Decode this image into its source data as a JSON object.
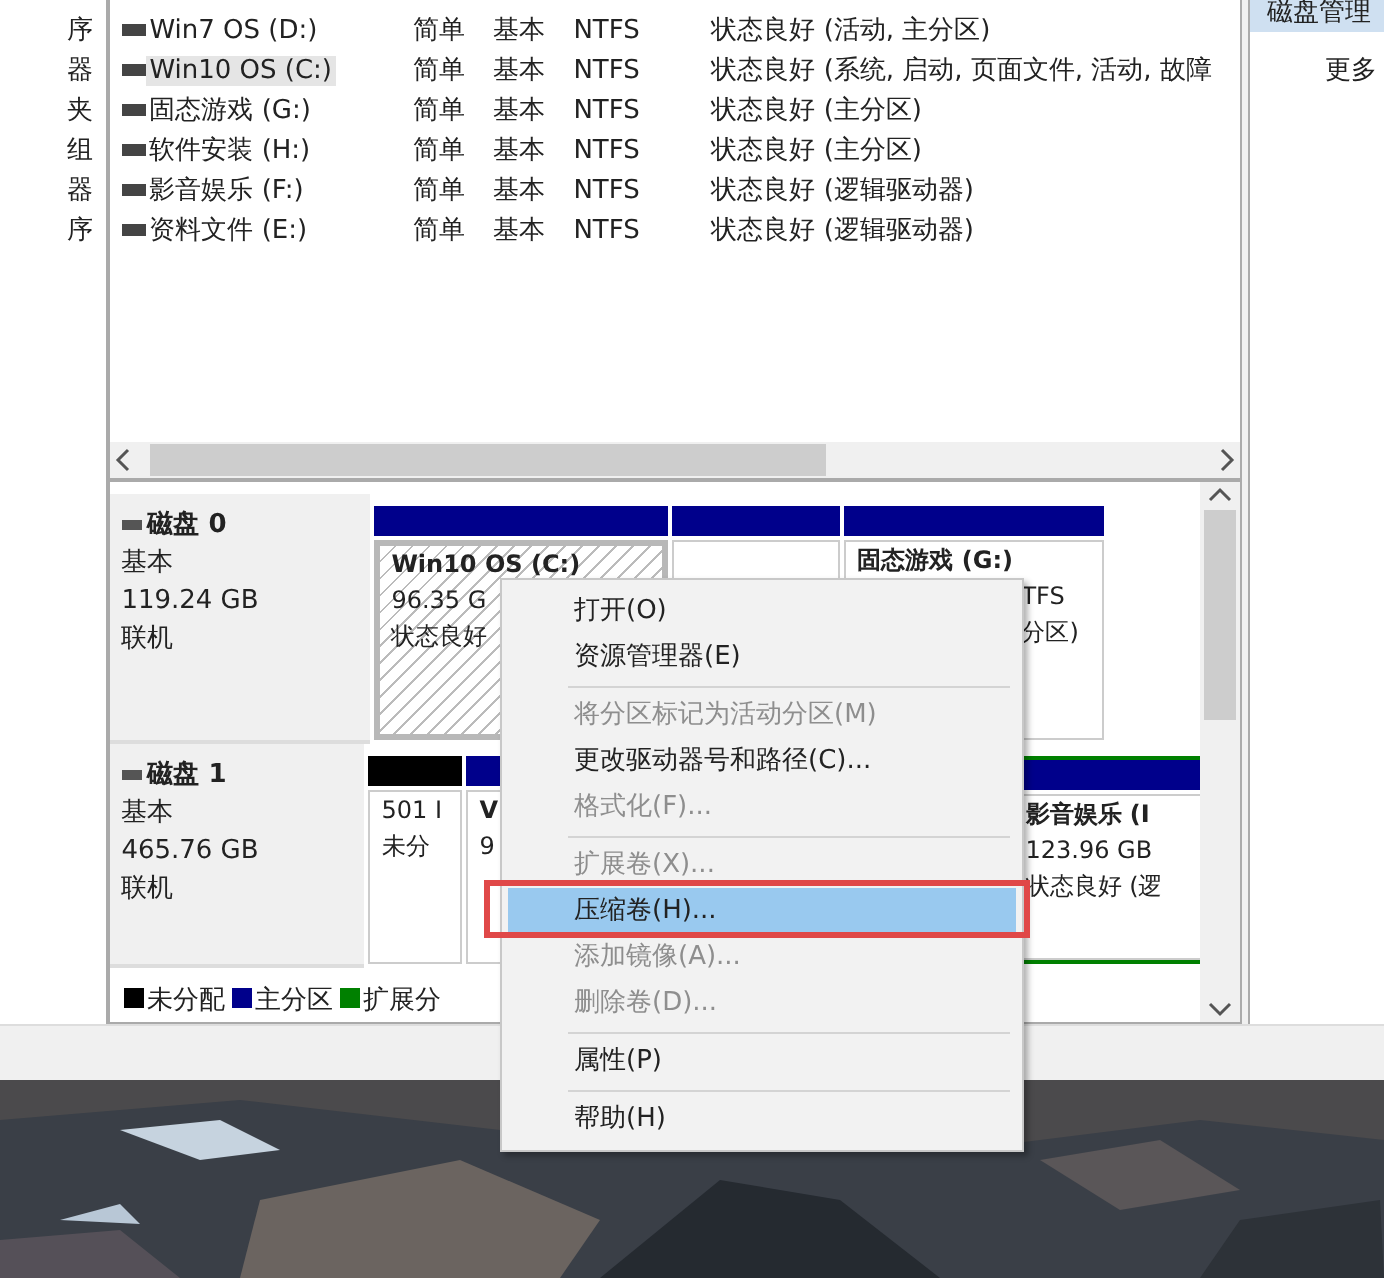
{
  "sidebar": {
    "items": [
      "序",
      "器",
      "夹",
      "组",
      "器",
      "序"
    ]
  },
  "volumes": [
    {
      "name": "Win7 OS (D:)",
      "layout": "简单",
      "type": "基本",
      "fs": "NTFS",
      "status": "状态良好 (活动, 主分区)",
      "selected": false
    },
    {
      "name": "Win10 OS (C:)",
      "layout": "简单",
      "type": "基本",
      "fs": "NTFS",
      "status": "状态良好 (系统, 启动, 页面文件, 活动, 故障",
      "selected": true
    },
    {
      "name": "固态游戏 (G:)",
      "layout": "简单",
      "type": "基本",
      "fs": "NTFS",
      "status": "状态良好 (主分区)",
      "selected": false
    },
    {
      "name": "软件安装 (H:)",
      "layout": "简单",
      "type": "基本",
      "fs": "NTFS",
      "status": "状态良好 (主分区)",
      "selected": false
    },
    {
      "name": "影音娱乐 (F:)",
      "layout": "简单",
      "type": "基本",
      "fs": "NTFS",
      "status": "状态良好 (逻辑驱动器)",
      "selected": false
    },
    {
      "name": "资料文件 (E:)",
      "layout": "简单",
      "type": "基本",
      "fs": "NTFS",
      "status": "状态良好 (逻辑驱动器)",
      "selected": false
    }
  ],
  "actions_panel": {
    "header": "磁盘管理",
    "items": [
      "更多"
    ]
  },
  "disks": [
    {
      "name": "磁盘 0",
      "type": "基本",
      "size": "119.24 GB",
      "status": "联机",
      "partitions": [
        {
          "kind": "primary",
          "title": "Win10 OS (C:)",
          "lines": [
            "96.35 G",
            "状态良好"
          ],
          "selected": true
        },
        {
          "kind": "primary",
          "selected": false
        },
        {
          "kind": "primary",
          "title": "固态游戏 (G:)",
          "lines": [
            "TFS",
            "分区)"
          ],
          "selected": false
        }
      ]
    },
    {
      "name": "磁盘 1",
      "type": "基本",
      "size": "465.76 GB",
      "status": "联机",
      "partitions": [
        {
          "kind": "unallocated",
          "lines": [
            "501 I",
            "未分"
          ],
          "selected": false
        },
        {
          "kind": "primary",
          "title": "V",
          "lines": [
            "9"
          ],
          "selected": false
        },
        {
          "kind": "extended",
          "title": "影音娱乐 (I",
          "lines": [
            "123.96 GB",
            "状态良好 (逻"
          ],
          "selected": false
        }
      ]
    }
  ],
  "legend": [
    {
      "label": "未分配",
      "color": "#000000"
    },
    {
      "label": "主分区",
      "color": "#00008b"
    },
    {
      "label": "扩展分",
      "color": "#008000"
    }
  ],
  "context_menu": [
    {
      "kind": "item",
      "label": "打开(O)",
      "disabled": false,
      "selected": false
    },
    {
      "kind": "item",
      "label": "资源管理器(E)",
      "disabled": false,
      "selected": false
    },
    {
      "kind": "separator"
    },
    {
      "kind": "item",
      "label": "将分区标记为活动分区(M)",
      "disabled": true,
      "selected": false
    },
    {
      "kind": "item",
      "label": "更改驱动器号和路径(C)...",
      "disabled": false,
      "selected": false
    },
    {
      "kind": "item",
      "label": "格式化(F)...",
      "disabled": true,
      "selected": false
    },
    {
      "kind": "separator"
    },
    {
      "kind": "item",
      "label": "扩展卷(X)...",
      "disabled": true,
      "selected": false
    },
    {
      "kind": "item",
      "label": "压缩卷(H)...",
      "disabled": false,
      "selected": true
    },
    {
      "kind": "item",
      "label": "添加镜像(A)...",
      "disabled": true,
      "selected": false
    },
    {
      "kind": "item",
      "label": "删除卷(D)...",
      "disabled": true,
      "selected": false
    },
    {
      "kind": "separator"
    },
    {
      "kind": "item",
      "label": "属性(P)",
      "disabled": false,
      "selected": false
    },
    {
      "kind": "separator"
    },
    {
      "kind": "item",
      "label": "帮助(H)",
      "disabled": false,
      "selected": false
    }
  ]
}
